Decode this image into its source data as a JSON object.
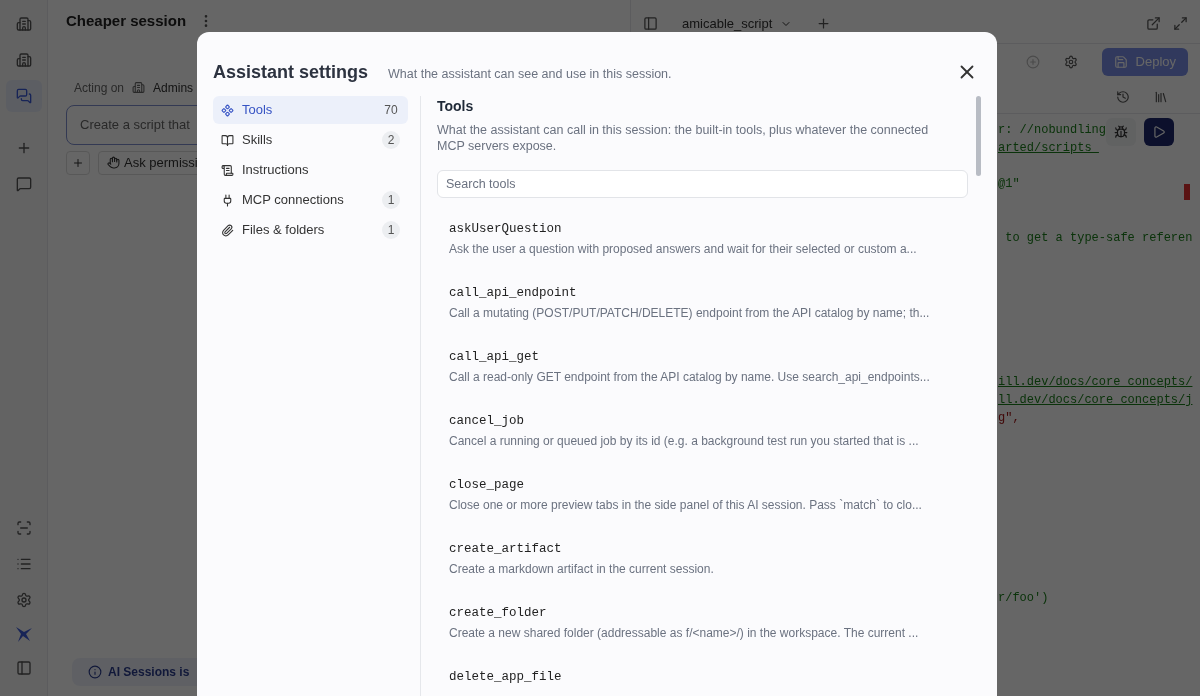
{
  "rail": {
    "top": [
      {
        "kind": "building",
        "selected": false
      },
      {
        "kind": "building",
        "selected": false
      },
      {
        "kind": "chats",
        "selected": true
      },
      {
        "kind": "plus",
        "selected": false
      },
      {
        "kind": "chat",
        "selected": false
      }
    ],
    "bottom": [
      {
        "kind": "scan"
      },
      {
        "kind": "list"
      },
      {
        "kind": "settings"
      },
      {
        "kind": "logo"
      },
      {
        "kind": "panel"
      }
    ]
  },
  "session": {
    "title": "Cheaper session",
    "acting_on": "Acting on",
    "workspace": "Admins",
    "prompt_placeholder": "Create a script that",
    "permission": "Ask permissi",
    "banner": "AI Sessions is"
  },
  "editor": {
    "tab": "amicable_script",
    "deploy": "Deploy",
    "code_lines": [
      {
        "kind": "comment",
        "text": "r: //nobundling"
      },
      {
        "kind": "link",
        "text": "arted/scripts_"
      },
      {
        "kind": "blank"
      },
      {
        "kind": "comment",
        "text": "@1\""
      },
      {
        "kind": "blank"
      },
      {
        "kind": "blank"
      },
      {
        "kind": "comment",
        "text": " to get a type-safe referen"
      },
      {
        "kind": "blank"
      },
      {
        "kind": "blank"
      },
      {
        "kind": "blank"
      },
      {
        "kind": "blank"
      },
      {
        "kind": "blank"
      },
      {
        "kind": "blank"
      },
      {
        "kind": "blank"
      },
      {
        "kind": "link",
        "text": "ill.dev/docs/core_concepts/"
      },
      {
        "kind": "link",
        "text": "ll.dev/docs/core_concepts/j"
      },
      {
        "kind": "string",
        "text": "g\","
      },
      {
        "kind": "blank"
      },
      {
        "kind": "blank"
      },
      {
        "kind": "blank"
      },
      {
        "kind": "blank"
      },
      {
        "kind": "blank"
      },
      {
        "kind": "blank"
      },
      {
        "kind": "blank"
      },
      {
        "kind": "blank"
      },
      {
        "kind": "blank"
      },
      {
        "kind": "comment",
        "text": "r/foo')"
      }
    ]
  },
  "dialog": {
    "title": "Assistant settings",
    "subtitle": "What the assistant can see and use in this session.",
    "nav": [
      {
        "kind": "tools",
        "label": "Tools",
        "count": "70",
        "selected": true
      },
      {
        "kind": "skills",
        "label": "Skills",
        "count": "2",
        "selected": false
      },
      {
        "kind": "instructions",
        "label": "Instructions",
        "selected": false
      },
      {
        "kind": "mcp",
        "label": "MCP connections",
        "count": "1",
        "selected": false
      },
      {
        "kind": "files",
        "label": "Files & folders",
        "count": "1",
        "selected": false
      }
    ],
    "section_title": "Tools",
    "section_description": "What the assistant can call in this session: the built-in tools, plus whatever the connected MCP servers expose.",
    "search_placeholder": "Search tools",
    "tools": [
      {
        "name": "askUserQuestion",
        "description": "Ask the user a question with proposed answers and wait for their selected or custom a..."
      },
      {
        "name": "call_api_endpoint",
        "description": "Call a mutating (POST/PUT/PATCH/DELETE) endpoint from the API catalog by name; th..."
      },
      {
        "name": "call_api_get",
        "description": "Call a read-only GET endpoint from the API catalog by name. Use search_api_endpoints..."
      },
      {
        "name": "cancel_job",
        "description": "Cancel a running or queued job by its id (e.g. a background test run you started that is ..."
      },
      {
        "name": "close_page",
        "description": "Close one or more preview tabs in the side panel of this AI session. Pass `match` to clo..."
      },
      {
        "name": "create_artifact",
        "description": "Create a markdown artifact in the current session."
      },
      {
        "name": "create_folder",
        "description": "Create a new shared folder (addressable as f/<name>/) in the workspace. The current ..."
      },
      {
        "name": "delete_app_file"
      }
    ]
  }
}
